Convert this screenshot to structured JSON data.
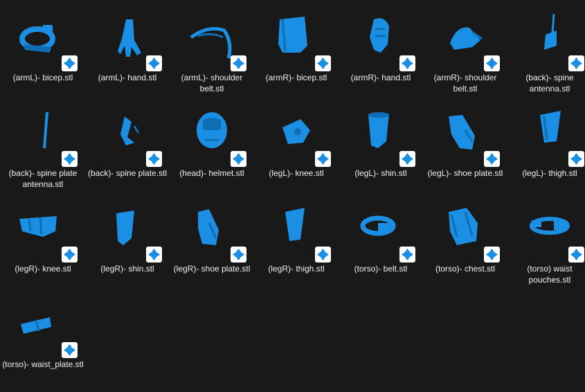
{
  "accent": "#1a8fe3",
  "file_icon": "3d-print-file-icon",
  "files": [
    {
      "name": "(armL)- bicep.stl",
      "shape": "ring"
    },
    {
      "name": "(armL)- hand.stl",
      "shape": "hand"
    },
    {
      "name": "(armL)- shoulder belt.stl",
      "shape": "arc"
    },
    {
      "name": "(armR)- bicep.stl",
      "shape": "cuff"
    },
    {
      "name": "(armR)- hand.stl",
      "shape": "glove"
    },
    {
      "name": "(armR)- shoulder belt.stl",
      "shape": "pad"
    },
    {
      "name": "(back)- spine antenna.stl",
      "shape": "antenna"
    },
    {
      "name": "(back)- spine plate antenna.stl",
      "shape": "stick"
    },
    {
      "name": "(back)- spine plate.stl",
      "shape": "plate"
    },
    {
      "name": "(head)- helmet.stl",
      "shape": "helmet"
    },
    {
      "name": "(legL)- knee.stl",
      "shape": "knee"
    },
    {
      "name": "(legL)- shin.stl",
      "shape": "shin"
    },
    {
      "name": "(legL)- shoe plate.stl",
      "shape": "shoe"
    },
    {
      "name": "(legL)- thigh.stl",
      "shape": "thigh"
    },
    {
      "name": "(legR)- knee.stl",
      "shape": "kneeR"
    },
    {
      "name": "(legR)- shin.stl",
      "shape": "shinR"
    },
    {
      "name": "(legR)- shoe plate.stl",
      "shape": "shoeR"
    },
    {
      "name": "(legR)- thigh.stl",
      "shape": "thighR"
    },
    {
      "name": "(torso)- belt.stl",
      "shape": "belt"
    },
    {
      "name": "(torso)- chest.stl",
      "shape": "chest"
    },
    {
      "name": "(torso) waist pouches.stl",
      "shape": "pouches"
    },
    {
      "name": "(torso)- waist_plate.stl",
      "shape": "waist"
    }
  ]
}
